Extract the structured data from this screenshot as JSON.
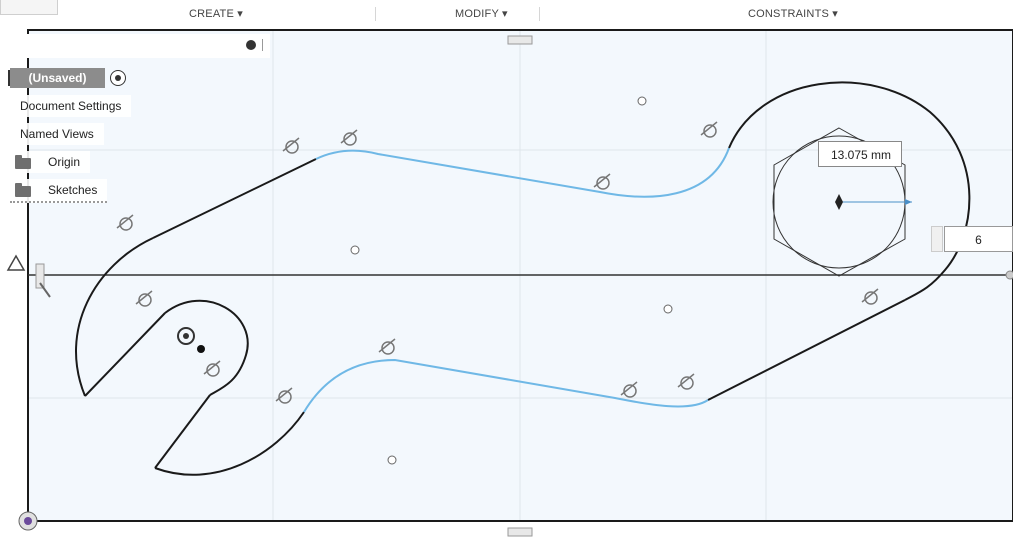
{
  "toolbar": {
    "create": "CREATE ▾",
    "modify": "MODIFY ▾",
    "constraints": "CONSTRAINTS ▾"
  },
  "browser": {
    "document_name": "(Unsaved)",
    "items": [
      {
        "label": "Document Settings"
      },
      {
        "label": "Named Views"
      },
      {
        "label": "Origin"
      },
      {
        "label": "Sketches"
      }
    ]
  },
  "dimension_input": {
    "value": "13.075 mm"
  },
  "polygon_sides_input": {
    "value": "6"
  },
  "colors": {
    "canvas": "#f3f8fd",
    "sketch_line": "#1a1a1a",
    "selected_line": "#6fb8e6",
    "grid": "#dfe6ec"
  }
}
